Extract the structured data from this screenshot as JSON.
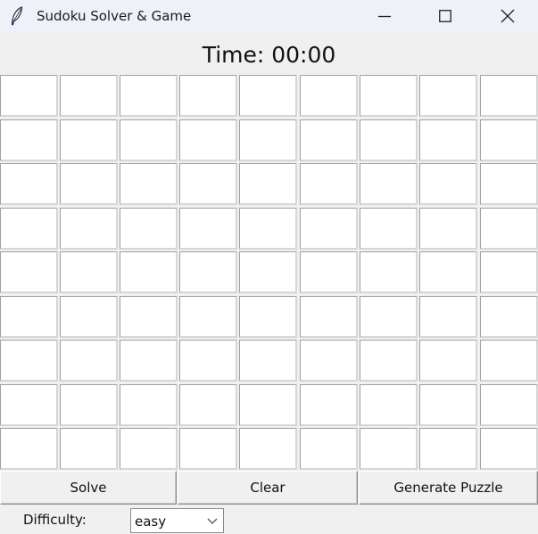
{
  "window": {
    "title": "Sudoku Solver & Game",
    "app_icon": "feather-icon",
    "controls": [
      "minimize-icon",
      "maximize-icon",
      "close-icon"
    ]
  },
  "timer": {
    "text": "Time: 00:00"
  },
  "grid": {
    "rows": 9,
    "cols": 9,
    "values": [
      [
        "",
        "",
        "",
        "",
        "",
        "",
        "",
        "",
        ""
      ],
      [
        "",
        "",
        "",
        "",
        "",
        "",
        "",
        "",
        ""
      ],
      [
        "",
        "",
        "",
        "",
        "",
        "",
        "",
        "",
        ""
      ],
      [
        "",
        "",
        "",
        "",
        "",
        "",
        "",
        "",
        ""
      ],
      [
        "",
        "",
        "",
        "",
        "",
        "",
        "",
        "",
        ""
      ],
      [
        "",
        "",
        "",
        "",
        "",
        "",
        "",
        "",
        ""
      ],
      [
        "",
        "",
        "",
        "",
        "",
        "",
        "",
        "",
        ""
      ],
      [
        "",
        "",
        "",
        "",
        "",
        "",
        "",
        "",
        ""
      ],
      [
        "",
        "",
        "",
        "",
        "",
        "",
        "",
        "",
        ""
      ]
    ]
  },
  "buttons": {
    "solve": "Solve",
    "clear": "Clear",
    "generate": "Generate Puzzle"
  },
  "difficulty": {
    "label": "Difficulty:",
    "selected": "easy",
    "dropdown_icon": "chevron-down-icon"
  }
}
